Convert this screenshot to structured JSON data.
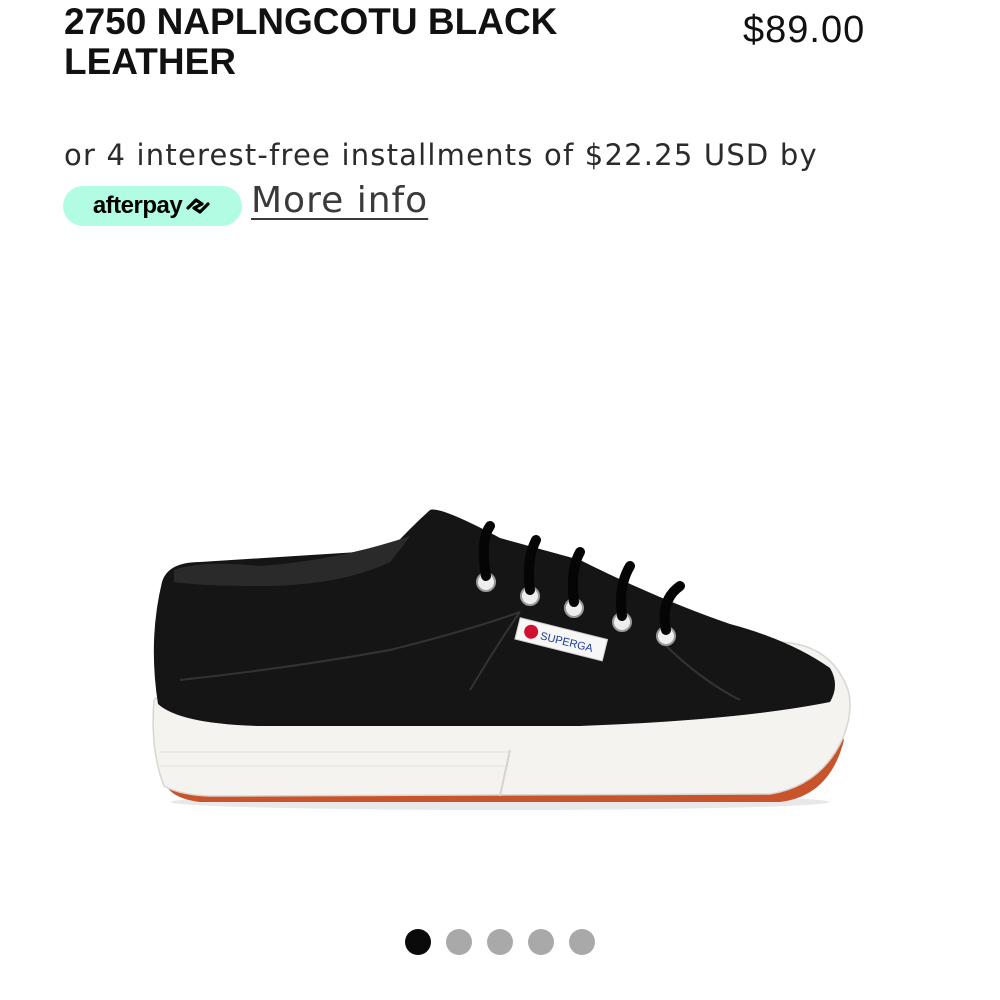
{
  "product": {
    "title": "2750 NAPLNGCOTU BLACK LEATHER",
    "price": "$89.00"
  },
  "afterpay": {
    "installments_text": "or 4 interest-free installments of $22.25 USD by",
    "brand_label": "afterpay",
    "more_info_label": "More info",
    "badge_color": "#b2fce4"
  },
  "image": {
    "label_brand": "SUPERGA"
  },
  "carousel": {
    "active_index": 0,
    "count": 5
  }
}
